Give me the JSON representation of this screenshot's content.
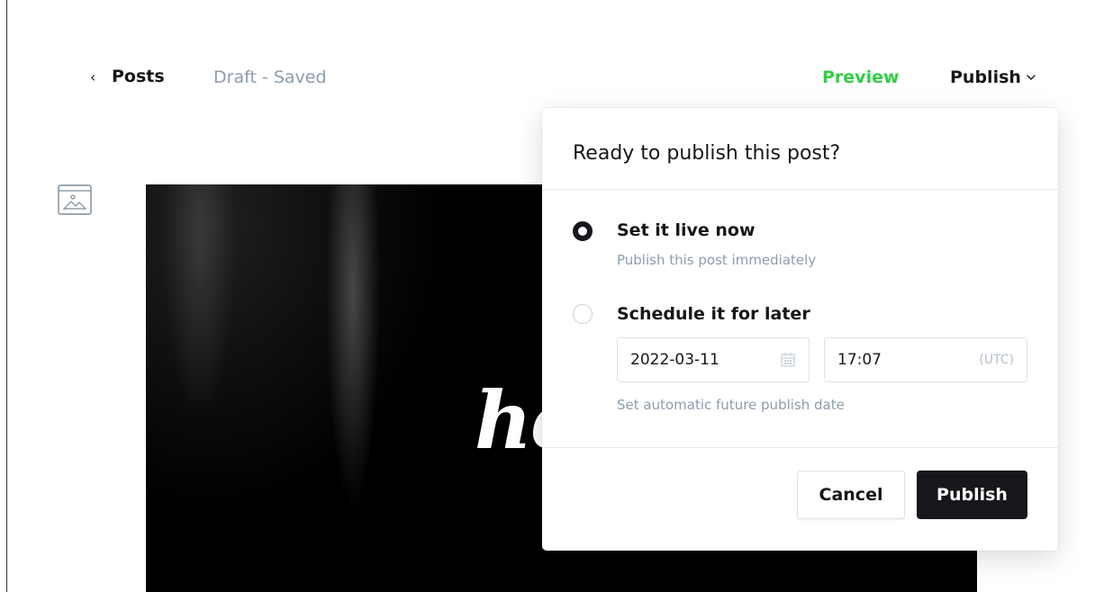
{
  "header": {
    "back_label": "Posts",
    "status": "Draft - Saved",
    "preview_label": "Preview",
    "publish_label": "Publish"
  },
  "feature_image": {
    "overlay_text": "he"
  },
  "publish_dropdown": {
    "title": "Ready to publish this post?",
    "options": [
      {
        "label": "Set it live now",
        "description": "Publish this post immediately",
        "selected": true
      },
      {
        "label": "Schedule it for later",
        "description": "Set automatic future publish date",
        "selected": false
      }
    ],
    "schedule": {
      "date": "2022-03-11",
      "time": "17:07",
      "timezone": "(UTC)"
    },
    "cancel_label": "Cancel",
    "publish_label": "Publish"
  },
  "colors": {
    "accent_green": "#30cf43",
    "text_dark": "#15171a",
    "text_muted": "#8e9cac"
  },
  "icons": {
    "back": "chevron-left-icon",
    "dropdown": "chevron-down-icon",
    "image": "image-icon",
    "calendar": "calendar-icon"
  }
}
